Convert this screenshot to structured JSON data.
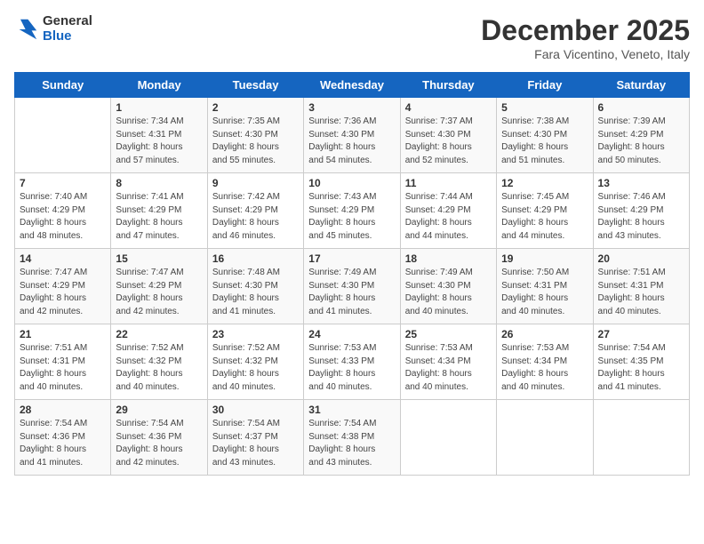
{
  "logo": {
    "line1": "General",
    "line2": "Blue"
  },
  "header": {
    "month": "December 2025",
    "location": "Fara Vicentino, Veneto, Italy"
  },
  "weekdays": [
    "Sunday",
    "Monday",
    "Tuesday",
    "Wednesday",
    "Thursday",
    "Friday",
    "Saturday"
  ],
  "weeks": [
    [
      {
        "day": "",
        "info": ""
      },
      {
        "day": "1",
        "info": "Sunrise: 7:34 AM\nSunset: 4:31 PM\nDaylight: 8 hours\nand 57 minutes."
      },
      {
        "day": "2",
        "info": "Sunrise: 7:35 AM\nSunset: 4:30 PM\nDaylight: 8 hours\nand 55 minutes."
      },
      {
        "day": "3",
        "info": "Sunrise: 7:36 AM\nSunset: 4:30 PM\nDaylight: 8 hours\nand 54 minutes."
      },
      {
        "day": "4",
        "info": "Sunrise: 7:37 AM\nSunset: 4:30 PM\nDaylight: 8 hours\nand 52 minutes."
      },
      {
        "day": "5",
        "info": "Sunrise: 7:38 AM\nSunset: 4:30 PM\nDaylight: 8 hours\nand 51 minutes."
      },
      {
        "day": "6",
        "info": "Sunrise: 7:39 AM\nSunset: 4:29 PM\nDaylight: 8 hours\nand 50 minutes."
      }
    ],
    [
      {
        "day": "7",
        "info": "Sunrise: 7:40 AM\nSunset: 4:29 PM\nDaylight: 8 hours\nand 48 minutes."
      },
      {
        "day": "8",
        "info": "Sunrise: 7:41 AM\nSunset: 4:29 PM\nDaylight: 8 hours\nand 47 minutes."
      },
      {
        "day": "9",
        "info": "Sunrise: 7:42 AM\nSunset: 4:29 PM\nDaylight: 8 hours\nand 46 minutes."
      },
      {
        "day": "10",
        "info": "Sunrise: 7:43 AM\nSunset: 4:29 PM\nDaylight: 8 hours\nand 45 minutes."
      },
      {
        "day": "11",
        "info": "Sunrise: 7:44 AM\nSunset: 4:29 PM\nDaylight: 8 hours\nand 44 minutes."
      },
      {
        "day": "12",
        "info": "Sunrise: 7:45 AM\nSunset: 4:29 PM\nDaylight: 8 hours\nand 44 minutes."
      },
      {
        "day": "13",
        "info": "Sunrise: 7:46 AM\nSunset: 4:29 PM\nDaylight: 8 hours\nand 43 minutes."
      }
    ],
    [
      {
        "day": "14",
        "info": "Sunrise: 7:47 AM\nSunset: 4:29 PM\nDaylight: 8 hours\nand 42 minutes."
      },
      {
        "day": "15",
        "info": "Sunrise: 7:47 AM\nSunset: 4:29 PM\nDaylight: 8 hours\nand 42 minutes."
      },
      {
        "day": "16",
        "info": "Sunrise: 7:48 AM\nSunset: 4:30 PM\nDaylight: 8 hours\nand 41 minutes."
      },
      {
        "day": "17",
        "info": "Sunrise: 7:49 AM\nSunset: 4:30 PM\nDaylight: 8 hours\nand 41 minutes."
      },
      {
        "day": "18",
        "info": "Sunrise: 7:49 AM\nSunset: 4:30 PM\nDaylight: 8 hours\nand 40 minutes."
      },
      {
        "day": "19",
        "info": "Sunrise: 7:50 AM\nSunset: 4:31 PM\nDaylight: 8 hours\nand 40 minutes."
      },
      {
        "day": "20",
        "info": "Sunrise: 7:51 AM\nSunset: 4:31 PM\nDaylight: 8 hours\nand 40 minutes."
      }
    ],
    [
      {
        "day": "21",
        "info": "Sunrise: 7:51 AM\nSunset: 4:31 PM\nDaylight: 8 hours\nand 40 minutes."
      },
      {
        "day": "22",
        "info": "Sunrise: 7:52 AM\nSunset: 4:32 PM\nDaylight: 8 hours\nand 40 minutes."
      },
      {
        "day": "23",
        "info": "Sunrise: 7:52 AM\nSunset: 4:32 PM\nDaylight: 8 hours\nand 40 minutes."
      },
      {
        "day": "24",
        "info": "Sunrise: 7:53 AM\nSunset: 4:33 PM\nDaylight: 8 hours\nand 40 minutes."
      },
      {
        "day": "25",
        "info": "Sunrise: 7:53 AM\nSunset: 4:34 PM\nDaylight: 8 hours\nand 40 minutes."
      },
      {
        "day": "26",
        "info": "Sunrise: 7:53 AM\nSunset: 4:34 PM\nDaylight: 8 hours\nand 40 minutes."
      },
      {
        "day": "27",
        "info": "Sunrise: 7:54 AM\nSunset: 4:35 PM\nDaylight: 8 hours\nand 41 minutes."
      }
    ],
    [
      {
        "day": "28",
        "info": "Sunrise: 7:54 AM\nSunset: 4:36 PM\nDaylight: 8 hours\nand 41 minutes."
      },
      {
        "day": "29",
        "info": "Sunrise: 7:54 AM\nSunset: 4:36 PM\nDaylight: 8 hours\nand 42 minutes."
      },
      {
        "day": "30",
        "info": "Sunrise: 7:54 AM\nSunset: 4:37 PM\nDaylight: 8 hours\nand 43 minutes."
      },
      {
        "day": "31",
        "info": "Sunrise: 7:54 AM\nSunset: 4:38 PM\nDaylight: 8 hours\nand 43 minutes."
      },
      {
        "day": "",
        "info": ""
      },
      {
        "day": "",
        "info": ""
      },
      {
        "day": "",
        "info": ""
      }
    ]
  ]
}
